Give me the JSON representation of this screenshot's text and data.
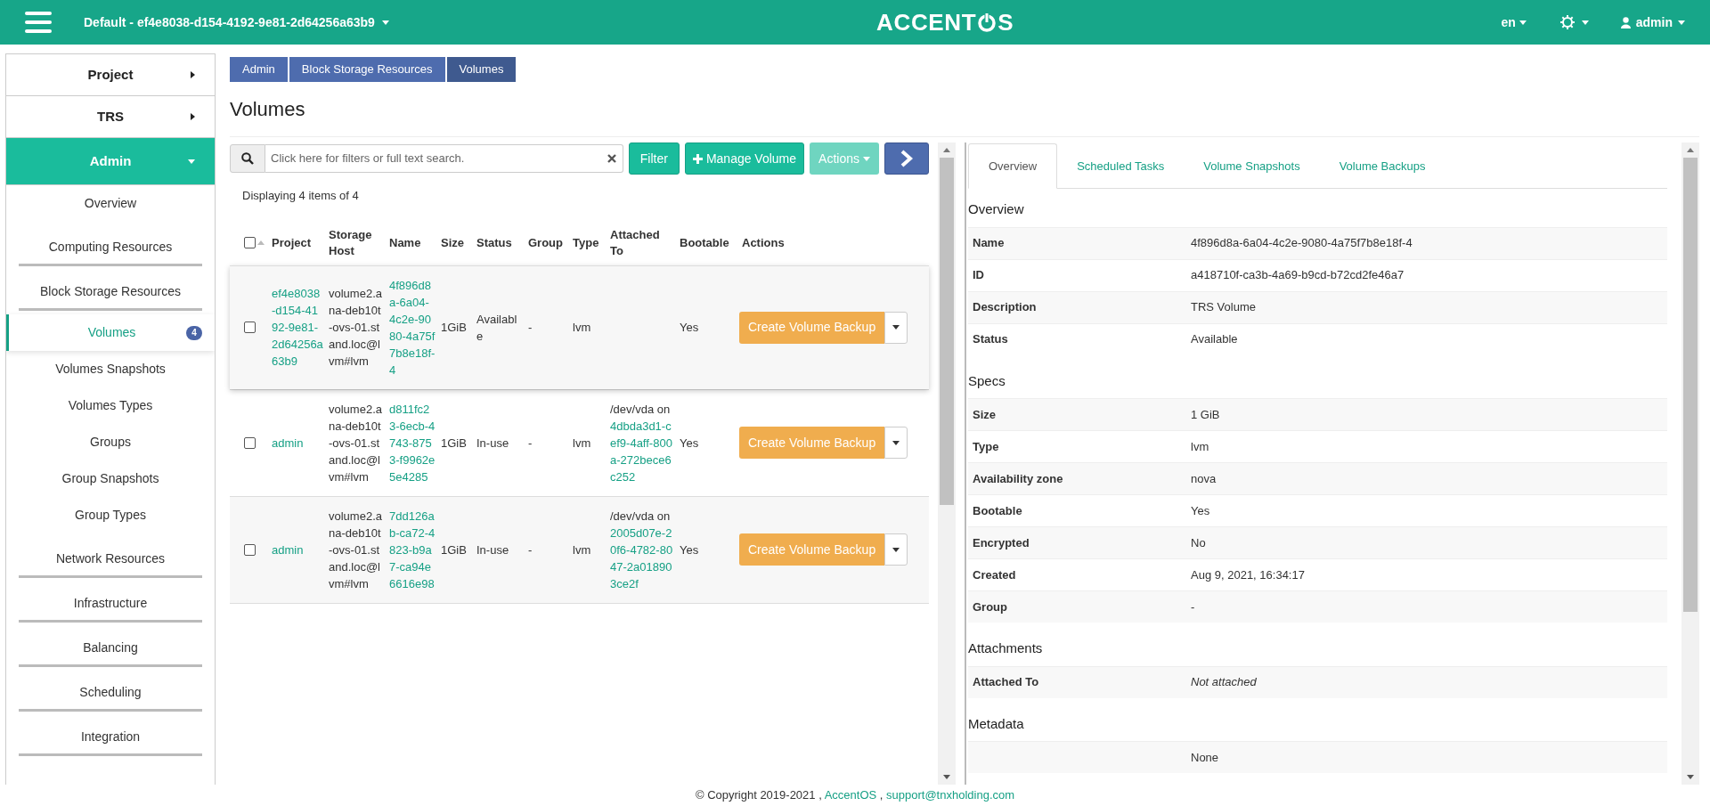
{
  "header": {
    "project_selector": "Default - ef4e8038-d154-4192-9e81-2d64256a63b9",
    "logo_left": "ACCENT",
    "logo_right": "S",
    "language": "en",
    "user": "admin"
  },
  "sidebar": {
    "items": [
      {
        "label": "Project",
        "kind": "panel",
        "expanded": false
      },
      {
        "label": "TRS",
        "kind": "panel",
        "expanded": false
      },
      {
        "label": "Admin",
        "kind": "panel",
        "expanded": true,
        "children": [
          {
            "label": "Overview",
            "kind": "link",
            "selected": false
          },
          {
            "label": "Computing Resources",
            "kind": "group",
            "expanded": false
          },
          {
            "label": "Block Storage Resources",
            "kind": "group",
            "expanded": true,
            "children": [
              {
                "label": "Volumes",
                "kind": "link",
                "selected": true,
                "badge": "4"
              },
              {
                "label": "Volumes Snapshots",
                "kind": "link",
                "selected": false
              },
              {
                "label": "Volumes Types",
                "kind": "link",
                "selected": false
              },
              {
                "label": "Groups",
                "kind": "link",
                "selected": false
              },
              {
                "label": "Group Snapshots",
                "kind": "link",
                "selected": false
              },
              {
                "label": "Group Types",
                "kind": "link",
                "selected": false
              }
            ]
          },
          {
            "label": "Network Resources",
            "kind": "group",
            "expanded": false
          },
          {
            "label": "Infrastructure",
            "kind": "group",
            "expanded": false
          },
          {
            "label": "Balancing",
            "kind": "group",
            "expanded": false
          },
          {
            "label": "Scheduling",
            "kind": "group",
            "expanded": false
          },
          {
            "label": "Integration",
            "kind": "group",
            "expanded": false
          }
        ]
      }
    ]
  },
  "breadcrumb": [
    "Admin",
    "Block Storage Resources",
    "Volumes"
  ],
  "page_title": "Volumes",
  "toolbar": {
    "search_placeholder": "Click here for filters or full text search.",
    "filter": "Filter",
    "manage": "Manage Volume",
    "actions": "Actions",
    "actions_disabled": true
  },
  "table": {
    "summary": "Displaying 4 items of 4",
    "select_all_checked": false,
    "columns": [
      "Project",
      "Storage Host",
      "Name",
      "Size",
      "Status",
      "Group",
      "Type",
      "Attached To",
      "Bootable",
      "Actions"
    ],
    "rows": [
      {
        "selected": true,
        "checked": false,
        "project": "ef4e8038-d154-4192-9e81-2d64256a63b9",
        "host": "volume2.ana-deb10t-ovs-01.stand.loc@lvm#lvm",
        "name": "4f896d8a-6a04-4c2e-9080-4a75f7b8e18f-4",
        "size": "1GiB",
        "status": "Available",
        "group": "-",
        "type": "lvm",
        "bootable": "Yes",
        "action": "Create Volume Backup"
      },
      {
        "selected": false,
        "checked": false,
        "project": "admin",
        "host": "volume2.ana-deb10t-ovs-01.stand.loc@lvm#lvm",
        "name": "d811fc23-6ecb-4743-8753-f9962e5e4285",
        "size": "1GiB",
        "status": "In-use",
        "group": "-",
        "type": "lvm",
        "attached_prefix": "/dev/vda on",
        "attached_link": "4dbda3d1-cef9-4aff-800a-272bece6c252",
        "bootable": "Yes",
        "action": "Create Volume Backup"
      },
      {
        "selected": false,
        "checked": false,
        "project": "admin",
        "host": "volume2.ana-deb10t-ovs-01.stand.loc@lvm#lvm",
        "name": "7dd126ab-ca72-4823-b9a7-ca94e6616e98",
        "size": "1GiB",
        "status": "In-use",
        "group": "-",
        "type": "lvm",
        "attached_prefix": "/dev/vda on",
        "attached_link": "2005d07e-20f6-4782-8047-2a018903ce2f",
        "bootable": "Yes",
        "action": "Create Volume Backup"
      }
    ]
  },
  "detail": {
    "tabs": [
      {
        "label": "Overview",
        "selected": true
      },
      {
        "label": "Scheduled Tasks",
        "selected": false
      },
      {
        "label": "Volume Snapshots",
        "selected": false
      },
      {
        "label": "Volume Backups",
        "selected": false
      }
    ],
    "sections": [
      {
        "title": "Overview",
        "rows": [
          {
            "label": "Name",
            "value": "4f896d8a-6a04-4c2e-9080-4a75f7b8e18f-4",
            "kind": "text"
          },
          {
            "label": "ID",
            "value": "a418710f-ca3b-4a69-b9cd-b72cd2fe46a7",
            "kind": "text"
          },
          {
            "label": "Description",
            "value": "TRS Volume",
            "kind": "text"
          },
          {
            "label": "Status",
            "value": "Available",
            "kind": "text"
          }
        ]
      },
      {
        "title": "Specs",
        "rows": [
          {
            "label": "Size",
            "value": "1 GiB",
            "kind": "text"
          },
          {
            "label": "Type",
            "value": "lvm",
            "kind": "text"
          },
          {
            "label": "Availability zone",
            "value": "nova",
            "kind": "text"
          },
          {
            "label": "Bootable",
            "value": "Yes",
            "kind": "text"
          },
          {
            "label": "Encrypted",
            "value": "No",
            "kind": "text"
          },
          {
            "label": "Created",
            "value": "Aug 9, 2021, 16:34:17",
            "kind": "text"
          },
          {
            "label": "Group",
            "value": "-",
            "kind": "text"
          }
        ]
      },
      {
        "title": "Attachments",
        "rows": [
          {
            "label": "Attached To",
            "value": "Not attached",
            "kind": "note"
          }
        ]
      },
      {
        "title": "Metadata",
        "rows": [
          {
            "value": "None",
            "kind": "text"
          }
        ]
      }
    ]
  },
  "footer": {
    "text": "© Copyright 2019-2021 ,",
    "separator": ",",
    "links": [
      "AccentOS",
      "support@tnxholding.com"
    ]
  }
}
